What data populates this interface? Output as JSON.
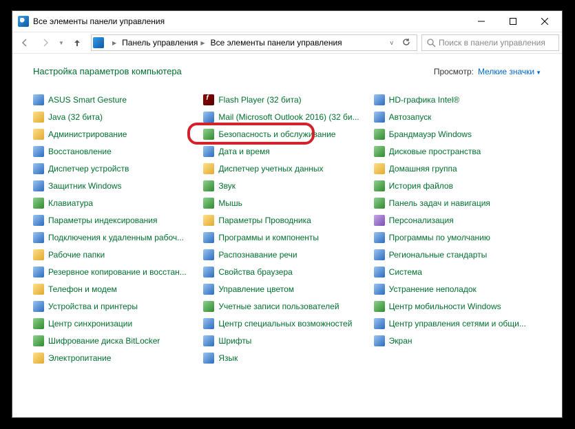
{
  "window": {
    "title": "Все элементы панели управления"
  },
  "breadcrumb": {
    "seg1": "Панель управления",
    "seg2": "Все элементы панели управления"
  },
  "search": {
    "placeholder": "Поиск в панели управления"
  },
  "heading": "Настройка параметров компьютера",
  "view": {
    "label": "Просмотр:",
    "value": "Мелкие значки"
  },
  "items": {
    "col1": [
      "ASUS Smart Gesture",
      "Java (32 бита)",
      "Администрирование",
      "Восстановление",
      "Диспетчер устройств",
      "Защитник Windows",
      "Клавиатура",
      "Параметры индексирования",
      "Подключения к удаленным рабоч...",
      "Рабочие папки",
      "Резервное копирование и восстан...",
      "Телефон и модем",
      "Устройства и принтеры",
      "Центр синхронизации",
      "Шифрование диска BitLocker",
      "Электропитание"
    ],
    "col2": [
      "Flash Player (32 бита)",
      "Mail (Microsoft Outlook 2016) (32 би...",
      "Безопасность и обслуживание",
      "Дата и время",
      "Диспетчер учетных данных",
      "Звук",
      "Мышь",
      "Параметры Проводника",
      "Программы и компоненты",
      "Распознавание речи",
      "Свойства браузера",
      "Управление цветом",
      "Учетные записи пользователей",
      "Центр специальных возможностей",
      "Шрифты",
      "Язык"
    ],
    "col3": [
      "HD-графика Intel®",
      "Автозапуск",
      "Брандмауэр Windows",
      "Дисковые пространства",
      "Домашняя группа",
      "История файлов",
      "Панель задач и навигация",
      "Персонализация",
      "Программы по умолчанию",
      "Региональные стандарты",
      "Система",
      "Устранение неполадок",
      "Центр мобильности Windows",
      "Центр управления сетями и общи...",
      "Экран"
    ]
  },
  "iconClasses": {
    "col1": [
      "b",
      "y",
      "y",
      "b",
      "b",
      "b",
      "",
      "b",
      "b",
      "y",
      "b",
      "y",
      "b",
      "",
      "",
      "y"
    ],
    "col2": [
      "r",
      "b",
      "",
      "b",
      "y",
      "",
      "",
      "y",
      "b",
      "b",
      "b",
      "b",
      "",
      "b",
      "b",
      "b"
    ],
    "col3": [
      "b",
      "b",
      "",
      "",
      "y",
      "",
      "",
      "p",
      "b",
      "b",
      "b",
      "b",
      "",
      "b",
      "b"
    ]
  }
}
